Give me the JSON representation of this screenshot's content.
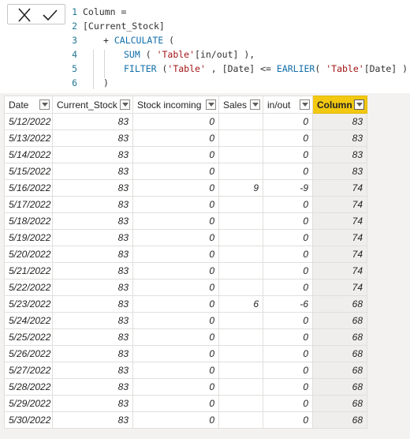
{
  "formula": {
    "lines": [
      {
        "num": "1",
        "tokens": [
          {
            "t": "Column =",
            "c": ""
          }
        ]
      },
      {
        "num": "2",
        "tokens": [
          {
            "t": "[Current_Stock]",
            "c": ""
          }
        ]
      },
      {
        "num": "3",
        "tokens": [
          {
            "t": "+ ",
            "c": ""
          },
          {
            "t": "CALCULATE",
            "c": "kw"
          },
          {
            "t": " (",
            "c": ""
          }
        ]
      },
      {
        "num": "4",
        "tokens": [
          {
            "t": "SUM",
            "c": "kw"
          },
          {
            "t": " ( ",
            "c": ""
          },
          {
            "t": "'Table'",
            "c": "str"
          },
          {
            "t": "[in/out] ),",
            "c": ""
          }
        ]
      },
      {
        "num": "5",
        "tokens": [
          {
            "t": "FILTER",
            "c": "kw"
          },
          {
            "t": " (",
            "c": ""
          },
          {
            "t": "'Table'",
            "c": "str"
          },
          {
            "t": " , [Date] <= ",
            "c": ""
          },
          {
            "t": "EARLIER",
            "c": "kw"
          },
          {
            "t": "( ",
            "c": ""
          },
          {
            "t": "'Table'",
            "c": "str"
          },
          {
            "t": "[Date] ) )",
            "c": ""
          }
        ]
      },
      {
        "num": "6",
        "tokens": [
          {
            "t": ")",
            "c": ""
          }
        ]
      }
    ]
  },
  "table": {
    "columns": [
      "Date",
      "Current_Stock",
      "Stock incoming",
      "Sales",
      "in/out",
      "Column"
    ],
    "active_column": "Column",
    "rows": [
      [
        "5/12/2022",
        "83",
        "0",
        "",
        "0",
        "83"
      ],
      [
        "5/13/2022",
        "83",
        "0",
        "",
        "0",
        "83"
      ],
      [
        "5/14/2022",
        "83",
        "0",
        "",
        "0",
        "83"
      ],
      [
        "5/15/2022",
        "83",
        "0",
        "",
        "0",
        "83"
      ],
      [
        "5/16/2022",
        "83",
        "0",
        "9",
        "-9",
        "74"
      ],
      [
        "5/17/2022",
        "83",
        "0",
        "",
        "0",
        "74"
      ],
      [
        "5/18/2022",
        "83",
        "0",
        "",
        "0",
        "74"
      ],
      [
        "5/19/2022",
        "83",
        "0",
        "",
        "0",
        "74"
      ],
      [
        "5/20/2022",
        "83",
        "0",
        "",
        "0",
        "74"
      ],
      [
        "5/21/2022",
        "83",
        "0",
        "",
        "0",
        "74"
      ],
      [
        "5/22/2022",
        "83",
        "0",
        "",
        "0",
        "74"
      ],
      [
        "5/23/2022",
        "83",
        "0",
        "6",
        "-6",
        "68"
      ],
      [
        "5/24/2022",
        "83",
        "0",
        "",
        "0",
        "68"
      ],
      [
        "5/25/2022",
        "83",
        "0",
        "",
        "0",
        "68"
      ],
      [
        "5/26/2022",
        "83",
        "0",
        "",
        "0",
        "68"
      ],
      [
        "5/27/2022",
        "83",
        "0",
        "",
        "0",
        "68"
      ],
      [
        "5/28/2022",
        "83",
        "0",
        "",
        "0",
        "68"
      ],
      [
        "5/29/2022",
        "83",
        "0",
        "",
        "0",
        "68"
      ],
      [
        "5/30/2022",
        "83",
        "0",
        "",
        "0",
        "68"
      ]
    ]
  },
  "colors": {
    "active_header": "#f2c811",
    "keyword": "#116eaa",
    "string": "#a31515",
    "line_number": "#237893"
  }
}
